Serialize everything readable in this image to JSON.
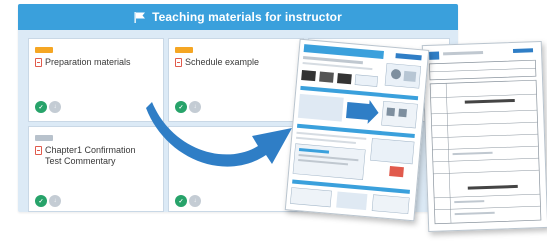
{
  "panel": {
    "header_title": "Teaching materials for instructor",
    "items": [
      {
        "title": "Preparation materials",
        "tag_color": "#f5a623"
      },
      {
        "title": "Schedule example",
        "tag_color": "#f5a623"
      },
      {
        "title": "Chapter1 Confirmation Test Commentary",
        "tag_color": "#b8c2cc"
      },
      {
        "title": "",
        "tag_color": "#f5a623"
      }
    ]
  },
  "colors": {
    "header": "#3aa0dc",
    "panel_bg": "#dceaf6",
    "arrow": "#2f7ec6",
    "doc_icon": "#e15a4c",
    "action_green": "#27a36a"
  },
  "icons": {
    "header": "flag-icon",
    "item": "document-icon",
    "arrow": "curved-arrow-icon"
  }
}
